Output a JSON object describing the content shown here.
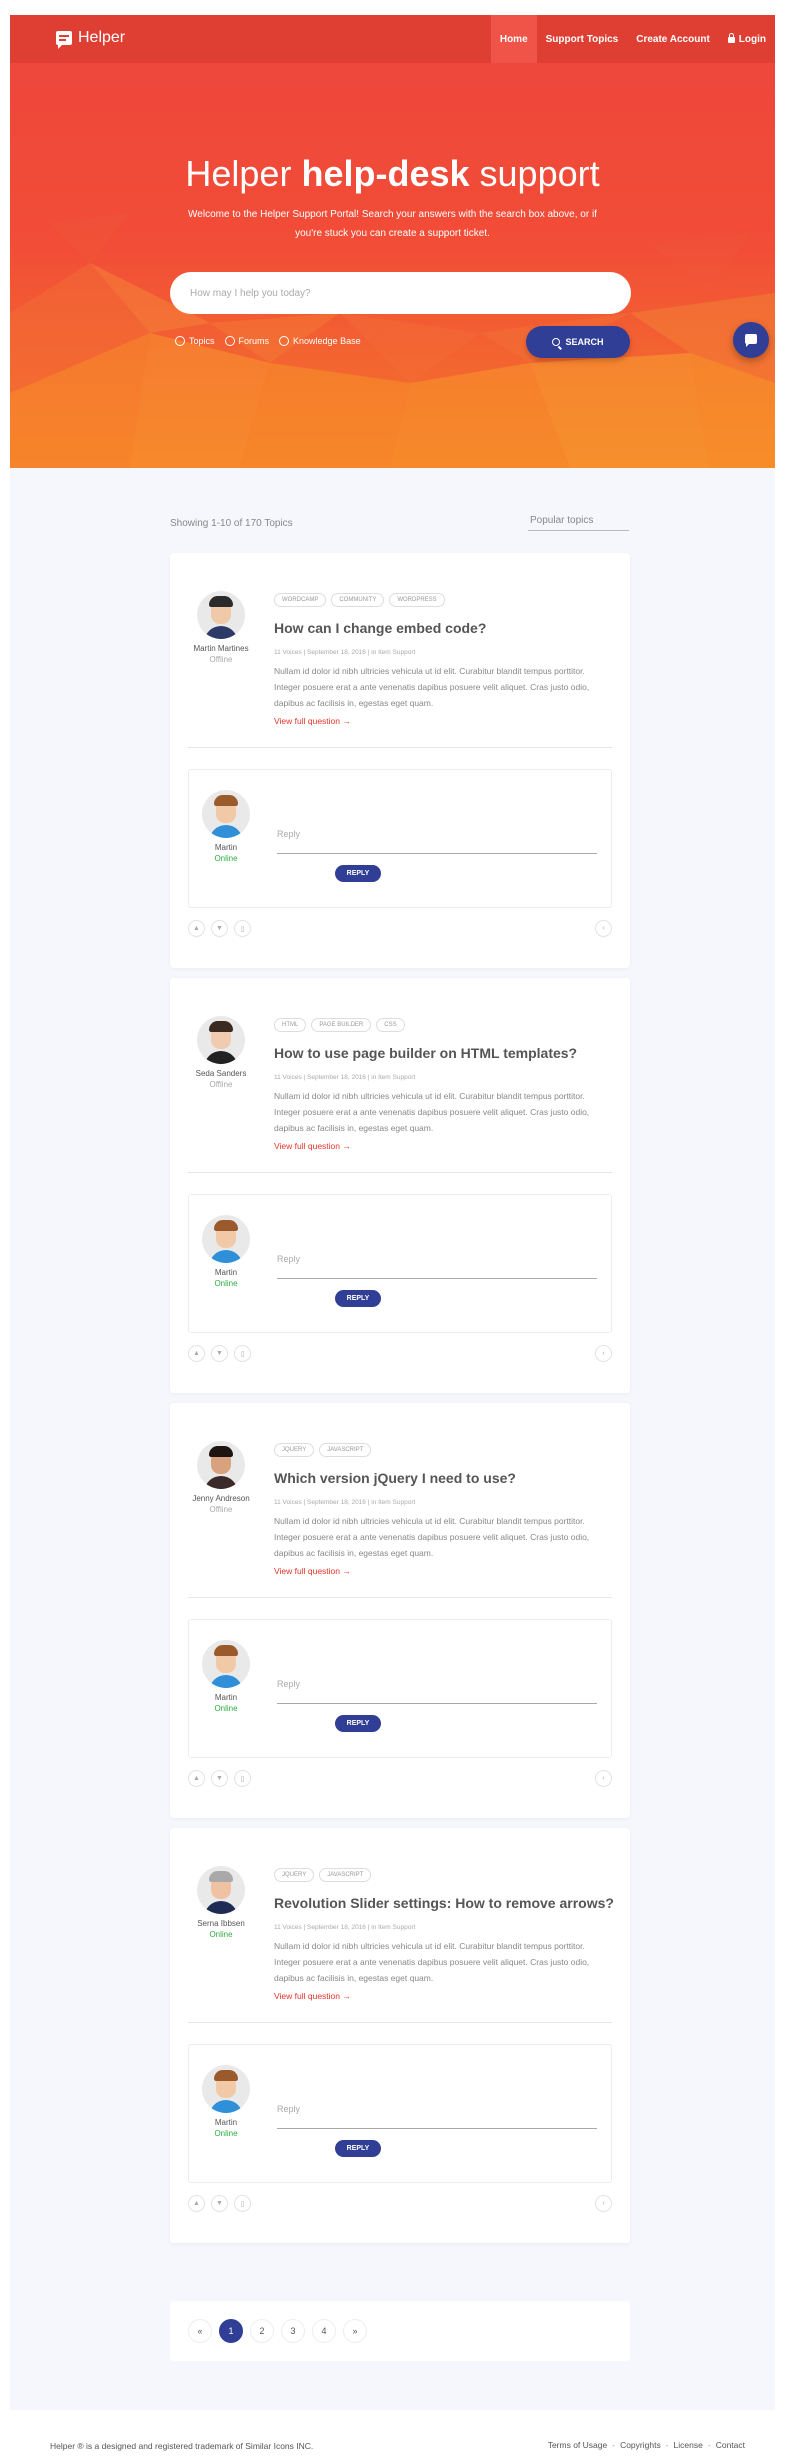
{
  "nav": {
    "brand": "Helper",
    "items": [
      {
        "label": "Home"
      },
      {
        "label": "Support Topics"
      },
      {
        "label": "Create Account"
      },
      {
        "label": "Login"
      }
    ]
  },
  "hero": {
    "title_light": "Helper",
    "title_bold": "help-desk",
    "title_light2": "support",
    "subtitle": "Welcome to the Helper Support Portal! Search your answers with the search box above, or if you're stuck you can create a support ticket.",
    "search_placeholder": "How may I help you today?",
    "radios": [
      "Topics",
      "Forums",
      "Knowledge Base"
    ],
    "search_button": "SEARCH"
  },
  "listing": {
    "showing": "Showing 1-10 of 170 Topics",
    "popular_placeholder": "Popular topics"
  },
  "topics": [
    {
      "author": "Martin Martines",
      "status": "Offline",
      "tags": [
        "WORDCAMP",
        "COMMUNITY",
        "WORDPRESS"
      ],
      "title": "How can I change embed code?",
      "meta": "11 Voices  |  September 18, 2016  |  in Item Support",
      "excerpt": "Nullam id dolor id nibh ultricies vehicula ut id elit. Curabitur blandit tempus porttitor. Integer posuere erat a ante venenatis dapibus posuere velit aliquet. Cras justo odio, dapibus ac facilisis in, egestas eget quam.",
      "more": "View full question →",
      "reply_author": "Martin",
      "reply_status": "Online",
      "reply_placeholder": "Reply",
      "reply_button": "REPLY"
    },
    {
      "author": "Seda Sanders",
      "status": "Offline",
      "tags": [
        "HTML",
        "PAGE BUILDER",
        "CSS"
      ],
      "title": "How to use page builder on HTML templates?",
      "meta": "11 Voices  |  September 18, 2016  |  in Item Support",
      "excerpt": "Nullam id dolor id nibh ultricies vehicula ut id elit. Curabitur blandit tempus porttitor. Integer posuere erat a ante venenatis dapibus posuere velit aliquet. Cras justo odio, dapibus ac facilisis in, egestas eget quam.",
      "more": "View full question →",
      "reply_author": "Martin",
      "reply_status": "Online",
      "reply_placeholder": "Reply",
      "reply_button": "REPLY"
    },
    {
      "author": "Jenny Andreson",
      "status": "Offline",
      "tags": [
        "JQUERY",
        "JAVASCRIPT"
      ],
      "title": "Which version jQuery I need to use?",
      "meta": "11 Voices  |  September 18, 2016  |  in Item Support",
      "excerpt": "Nullam id dolor id nibh ultricies vehicula ut id elit. Curabitur blandit tempus porttitor. Integer posuere erat a ante venenatis dapibus posuere velit aliquet. Cras justo odio, dapibus ac facilisis in, egestas eget quam.",
      "more": "View full question →",
      "reply_author": "Martin",
      "reply_status": "Online",
      "reply_placeholder": "Reply",
      "reply_button": "REPLY"
    },
    {
      "author": "Serna Ibbsen",
      "status": "Online",
      "tags": [
        "JQUERY",
        "JAVASCRIPT"
      ],
      "title": "Revolution Slider settings: How to remove arrows?",
      "meta": "11 Voices  |  September 18, 2016  |  in Item Support",
      "excerpt": "Nullam id dolor id nibh ultricies vehicula ut id elit. Curabitur blandit tempus porttitor. Integer posuere erat a ante venenatis dapibus posuere velit aliquet. Cras justo odio, dapibus ac facilisis in, egestas eget quam.",
      "more": "View full question →",
      "reply_author": "Martin",
      "reply_status": "Online",
      "reply_placeholder": "Reply",
      "reply_button": "REPLY"
    }
  ],
  "pagination": [
    "«",
    "1",
    "2",
    "3",
    "4",
    "»"
  ],
  "pagination_active": "1",
  "footer": {
    "trademark": "Helper ® is a designed and registered trademark of Similar Icons INC.",
    "links": [
      "Terms of Usage",
      "Copyrights",
      "License",
      "Contact"
    ]
  },
  "colors": {
    "primary": "#303e96",
    "nav": "#df3f33",
    "accent": "#e3332b",
    "online": "#2daa43"
  }
}
